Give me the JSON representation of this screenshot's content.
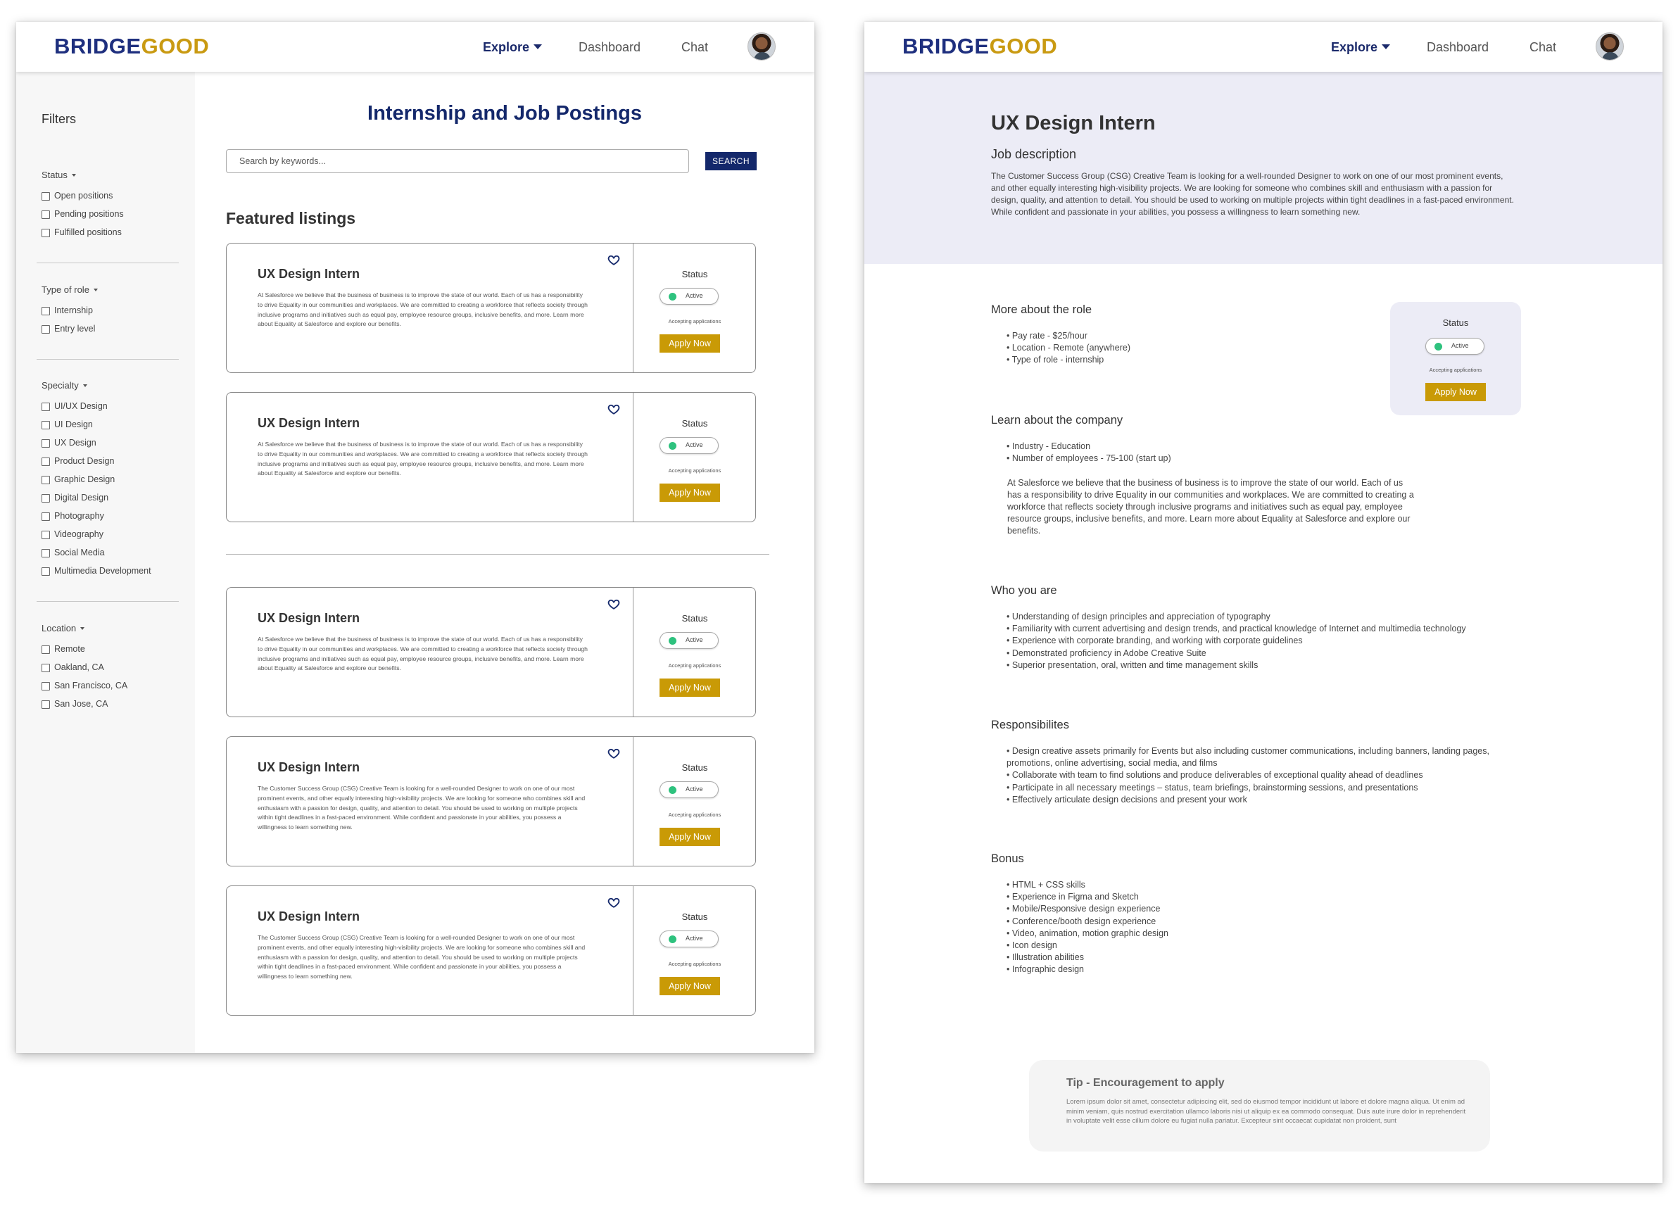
{
  "brand": {
    "part1": "BRIDGE",
    "part2": "GOOD",
    "color1": "#1e2f7e",
    "color2": "#c99a12"
  },
  "nav": {
    "explore": "Explore",
    "dashboard": "Dashboard",
    "chat": "Chat"
  },
  "filters": {
    "title": "Filters",
    "groups": [
      {
        "label": "Status",
        "options": [
          "Open positions",
          "Pending positions",
          "Fulfilled positions"
        ]
      },
      {
        "label": "Type of role",
        "options": [
          "Internship",
          "Entry level"
        ]
      },
      {
        "label": "Specialty",
        "options": [
          "UI/UX Design",
          "UI Design",
          "UX Design",
          "Product Design",
          "Graphic Design",
          "Digital Design",
          "Photography",
          "Videography",
          "Social Media",
          "Multimedia Development"
        ]
      },
      {
        "label": "Location",
        "options": [
          "Remote",
          "Oakland, CA",
          "San Francisco, CA",
          "San Jose, CA"
        ]
      }
    ]
  },
  "listings_page": {
    "title": "Internship and Job Postings",
    "search_placeholder": "Search by keywords...",
    "search_button": "SEARCH",
    "featured_heading": "Featured listings",
    "cards": [
      {
        "title": "UX Design Intern",
        "description": "At Salesforce we believe that the business of business is to improve the state of our world. Each of us has a responsibility to drive Equality in our communities and workplaces. We are committed to creating a workforce that reflects society through inclusive programs and initiatives such as equal pay, employee resource groups, inclusive benefits, and more. Learn more about Equality at Salesforce and explore our benefits.",
        "status_label": "Status",
        "status": "Active",
        "accepting": "Accepting applications",
        "apply": "Apply Now"
      },
      {
        "title": "UX Design Intern",
        "description": "At Salesforce we believe that the business of business is to improve the state of our world. Each of us has a responsibility to drive Equality in our communities and workplaces. We are committed to creating a workforce that reflects society through inclusive programs and initiatives such as equal pay, employee resource groups, inclusive benefits, and more. Learn more about Equality at Salesforce and explore our benefits.",
        "status_label": "Status",
        "status": "Active",
        "accepting": "Accepting applications",
        "apply": "Apply Now"
      },
      {
        "title": "UX Design Intern",
        "description": "At Salesforce we believe that the business of business is to improve the state of our world. Each of us has a responsibility to drive Equality in our communities and workplaces. We are committed to creating a workforce that reflects society through inclusive programs and initiatives such as equal pay, employee resource groups, inclusive benefits, and more. Learn more about Equality at Salesforce and explore our benefits.",
        "status_label": "Status",
        "status": "Active",
        "accepting": "Accepting applications",
        "apply": "Apply Now"
      },
      {
        "title": "UX Design Intern",
        "description": "The Customer Success Group (CSG) Creative Team is looking for a well-rounded Designer to work on one of our most prominent events, and other equally interesting high-visibility projects. We are looking for someone who combines skill and enthusiasm with a passion for design, quality, and attention to detail. You should be used to working on multiple projects within tight deadlines in a fast-paced environment. While confident and passionate in your abilities, you possess a willingness to learn something new.",
        "status_label": "Status",
        "status": "Active",
        "accepting": "Accepting applications",
        "apply": "Apply Now"
      },
      {
        "title": "UX Design Intern",
        "description": "The Customer Success Group (CSG) Creative Team is looking for a well-rounded Designer to work on one of our most prominent events, and other equally interesting high-visibility projects. We are looking for someone who combines skill and enthusiasm with a passion for design, quality, and attention to detail. You should be used to working on multiple projects within tight deadlines in a fast-paced environment. While confident and passionate in your abilities, you possess a willingness to learn something new.",
        "status_label": "Status",
        "status": "Active",
        "accepting": "Accepting applications",
        "apply": "Apply Now"
      }
    ]
  },
  "detail_page": {
    "title": "UX Design Intern",
    "subtitle": "Job description",
    "intro": "The Customer Success Group (CSG) Creative Team is looking for a well-rounded Designer to work on one of our most prominent events, and other equally interesting high-visibility projects. We are looking for someone who combines skill and enthusiasm with a passion for design, quality, and attention to detail. You should be used to working on multiple projects within tight deadlines in a fast-paced environment. While confident and passionate in your abilities, you possess a willingness to learn something new.",
    "status_box": {
      "status_label": "Status",
      "status": "Active",
      "accepting": "Accepting applications",
      "apply": "Apply Now"
    },
    "more_about": {
      "heading": "More about the role",
      "bullets": [
        "Pay rate - $25/hour",
        "Location - Remote (anywhere)",
        "Type of role - internship"
      ]
    },
    "company": {
      "heading": "Learn about the company",
      "bullets": [
        "Industry - Education",
        "Number of employees - 75-100 (start up)"
      ],
      "paragraph": "At Salesforce we believe that the business of business is to improve the state of our world. Each of us has a responsibility to drive Equality in our communities and workplaces. We are committed to creating a workforce that reflects society through inclusive programs and initiatives such as equal pay, employee resource groups, inclusive benefits, and more. Learn more about Equality at Salesforce and explore our benefits."
    },
    "who": {
      "heading": "Who you are",
      "bullets": [
        "Understanding of design principles and appreciation of typography",
        "Familiarity with current advertising and design trends, and practical knowledge of Internet and multimedia technology",
        "Experience with corporate branding, and working with corporate guidelines",
        "Demonstrated proficiency in Adobe Creative Suite",
        "Superior presentation, oral, written and time management skills"
      ]
    },
    "responsibilities": {
      "heading": "Responsibilites",
      "bullets": [
        "Design creative assets primarily for Events but also including customer communications, including banners, landing pages, promotions, online advertising, social media, and films",
        "Collaborate with team to find solutions and produce deliverables of exceptional quality ahead of deadlines",
        "Participate in all necessary meetings – status, team briefings, brainstorming sessions, and presentations",
        "Effectively articulate design decisions and present your work"
      ]
    },
    "bonus": {
      "heading": "Bonus",
      "bullets": [
        "HTML + CSS skills",
        "Experience in Figma and Sketch",
        "Mobile/Responsive design experience",
        "Conference/booth design experience",
        "Video, animation, motion graphic design",
        "Icon design",
        "Illustration abilities",
        "Infographic design"
      ]
    },
    "tip": {
      "title": "Tip - Encouragement to apply",
      "body": "Lorem ipsum dolor sit amet, consectetur adipiscing elit, sed do eiusmod tempor incididunt ut labore et dolore magna aliqua. Ut enim ad minim veniam, quis nostrud exercitation ullamco laboris nisi ut aliquip ex ea commodo consequat. Duis aute irure dolor in reprehenderit in voluptate velit esse cillum dolore eu fugiat nulla pariatur. Excepteur sint occaecat cupidatat non proident, sunt"
    }
  },
  "colors": {
    "primary": "#14286b",
    "accent": "#c99a06",
    "active": "#2ec27e",
    "hero_bg": "#ececf6"
  }
}
